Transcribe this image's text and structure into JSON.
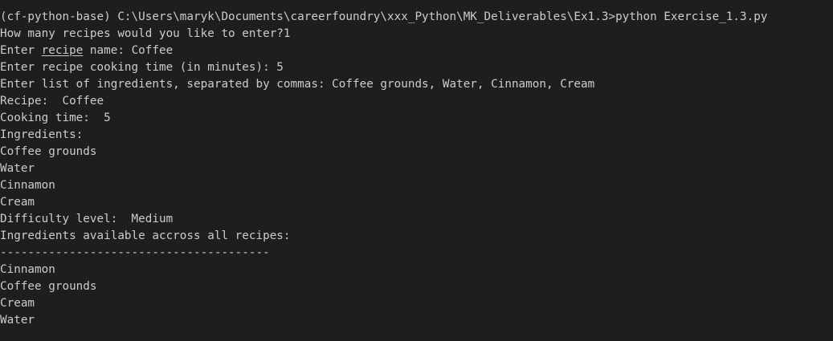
{
  "terminal": {
    "prompt_line": "(cf-python-base) C:\\Users\\maryk\\Documents\\careerfoundry\\xxx_Python\\MK_Deliverables\\Ex1.3>python Exercise_1.3.py",
    "how_many": "How many recipes would you like to enter?1",
    "enter_recipe_prefix": "Enter ",
    "enter_recipe_word": "recipe",
    "enter_recipe_suffix": " name: Coffee",
    "cooking_time_input": "Enter recipe cooking time (in minutes): 5",
    "ingredients_input": "Enter list of ingredients, separated by commas: Coffee grounds, Water, Cinnamon, Cream",
    "recipe_label": "Recipe:  Coffee",
    "cooking_time_label": "Cooking time:  5",
    "ingredients_header": "Ingredients:",
    "ingredients": [
      "Coffee grounds",
      "Water",
      "Cinnamon",
      "Cream"
    ],
    "difficulty": "Difficulty level:  Medium",
    "all_ingredients_header": "Ingredients available accross all recipes:",
    "separator": "---------------------------------------",
    "all_ingredients": [
      "Cinnamon",
      "Coffee grounds",
      "Cream",
      "Water"
    ]
  }
}
